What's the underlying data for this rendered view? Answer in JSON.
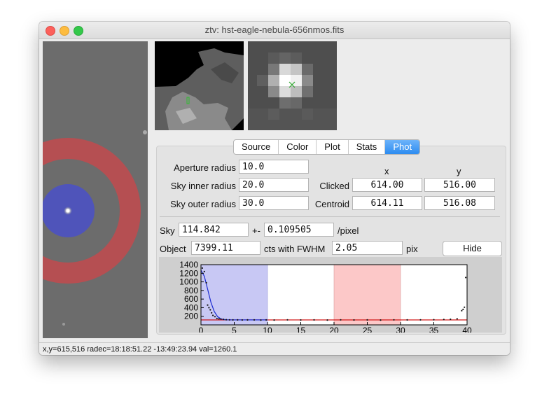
{
  "window": {
    "title": "ztv: hst-eagle-nebula-656nmos.fits"
  },
  "tabs": [
    {
      "label": "Source"
    },
    {
      "label": "Color"
    },
    {
      "label": "Plot"
    },
    {
      "label": "Stats"
    },
    {
      "label": "Phot",
      "active": true
    }
  ],
  "phot": {
    "aperture_radius_label": "Aperture radius",
    "aperture_radius_value": "10.0",
    "sky_inner_label": "Sky inner radius",
    "sky_inner_value": "20.0",
    "sky_outer_label": "Sky outer radius",
    "sky_outer_value": "30.0",
    "col_x": "x",
    "col_y": "y",
    "clicked_label": "Clicked",
    "clicked_x": "614.00",
    "clicked_y": "516.00",
    "centroid_label": "Centroid",
    "centroid_x": "614.11",
    "centroid_y": "516.08",
    "sky_label": "Sky",
    "sky_value": "114.842",
    "pm_label": "+-",
    "sky_err": "0.109505",
    "per_pixel": "/pixel",
    "object_label": "Object",
    "object_value": "7399.11",
    "cts_fwhm_label": "cts with FWHM",
    "fwhm_value": "2.05",
    "pix_label": "pix",
    "hide_button": "Hide"
  },
  "status": {
    "text": "x,y=615,516  radec=18:18:51.22 -13:49:23.94  val=1260.1"
  },
  "colors": {
    "aperture": "#4a50c8",
    "sky_annulus": "#c24a4e",
    "active_tab": "#2d8cf0",
    "profile_line": "#1a2ad0",
    "sky_fit_line": "#cc0000"
  },
  "chart_data": {
    "type": "scatter",
    "xlim": [
      0,
      40
    ],
    "ylim": [
      0,
      1400
    ],
    "x_ticks": [
      "0",
      "5",
      "10",
      "15",
      "20",
      "25",
      "30",
      "35",
      "40"
    ],
    "y_ticks": [
      "200",
      "400",
      "600",
      "800",
      "1000",
      "1200",
      "1400"
    ],
    "aperture_band": [
      0,
      10
    ],
    "sky_band": [
      20,
      30
    ],
    "sky_level": 114.842,
    "fit_curve": {
      "x": [
        0,
        0.5,
        1,
        1.5,
        2,
        2.5,
        3,
        3.5,
        4,
        5,
        6,
        8,
        10
      ],
      "y": [
        1270,
        1130,
        830,
        520,
        310,
        190,
        140,
        122,
        117,
        115,
        115,
        115,
        115
      ]
    },
    "points": {
      "x": [
        0.2,
        0.5,
        0.8,
        1.0,
        1.2,
        1.4,
        1.6,
        1.8,
        2.1,
        2.4,
        2.7,
        3.0,
        3.4,
        3.8,
        4.3,
        4.8,
        5.5,
        6.2,
        7.0,
        8.0,
        9.0,
        9.8,
        11,
        13,
        15,
        17,
        19,
        21,
        23,
        25,
        27,
        29,
        31,
        33,
        35,
        36.5,
        37.5,
        38.5,
        39.2,
        39.4,
        39.6,
        39.8
      ],
      "y": [
        1320,
        1240,
        980,
        460,
        400,
        350,
        280,
        220,
        190,
        150,
        140,
        135,
        128,
        120,
        118,
        116,
        115,
        114,
        116,
        115,
        113,
        116,
        112,
        118,
        114,
        116,
        113,
        117,
        114,
        116,
        113,
        118,
        115,
        117,
        120,
        125,
        130,
        140,
        330,
        360,
        410,
        1100
      ]
    }
  }
}
